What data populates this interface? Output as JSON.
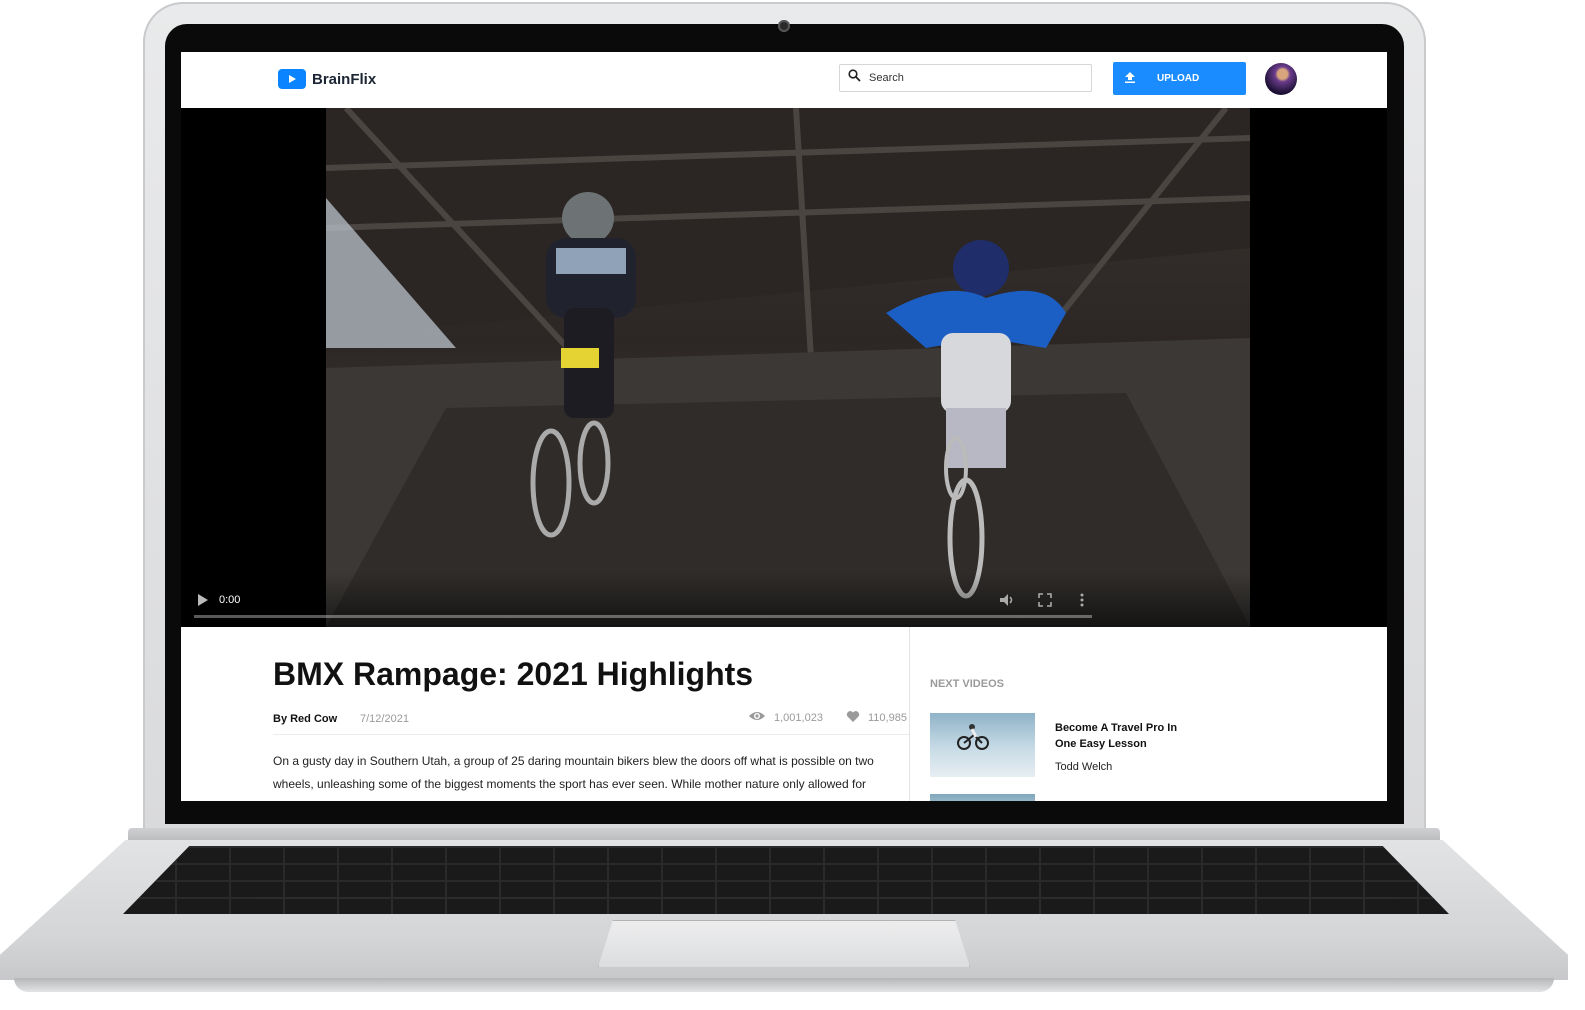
{
  "app": {
    "name": "BrainFlix"
  },
  "header": {
    "search_placeholder": "Search",
    "upload_label": "UPLOAD"
  },
  "player": {
    "time": "0:00",
    "progress": 0
  },
  "video": {
    "title": "BMX Rampage: 2021 Highlights",
    "author": "By Red Cow",
    "date": "7/12/2021",
    "views": "1,001,023",
    "likes": "110,985",
    "description": "On a gusty day in Southern Utah, a group of 25 daring mountain bikers blew the doors off what is possible on two wheels, unleashing some of the biggest moments the sport has ever seen. While mother nature only allowed for"
  },
  "sidebar": {
    "heading": "NEXT VIDEOS",
    "items": [
      {
        "title": "Become A Travel Pro In One Easy Lesson",
        "author": "Todd Welch"
      }
    ]
  },
  "colors": {
    "accent": "#1a8cff",
    "text": "#111111",
    "muted": "#9a9a9a"
  },
  "icons": [
    "play-icon",
    "search-icon",
    "upload-icon",
    "eye-icon",
    "heart-icon",
    "volume-icon",
    "fullscreen-icon",
    "more-vertical-icon"
  ]
}
